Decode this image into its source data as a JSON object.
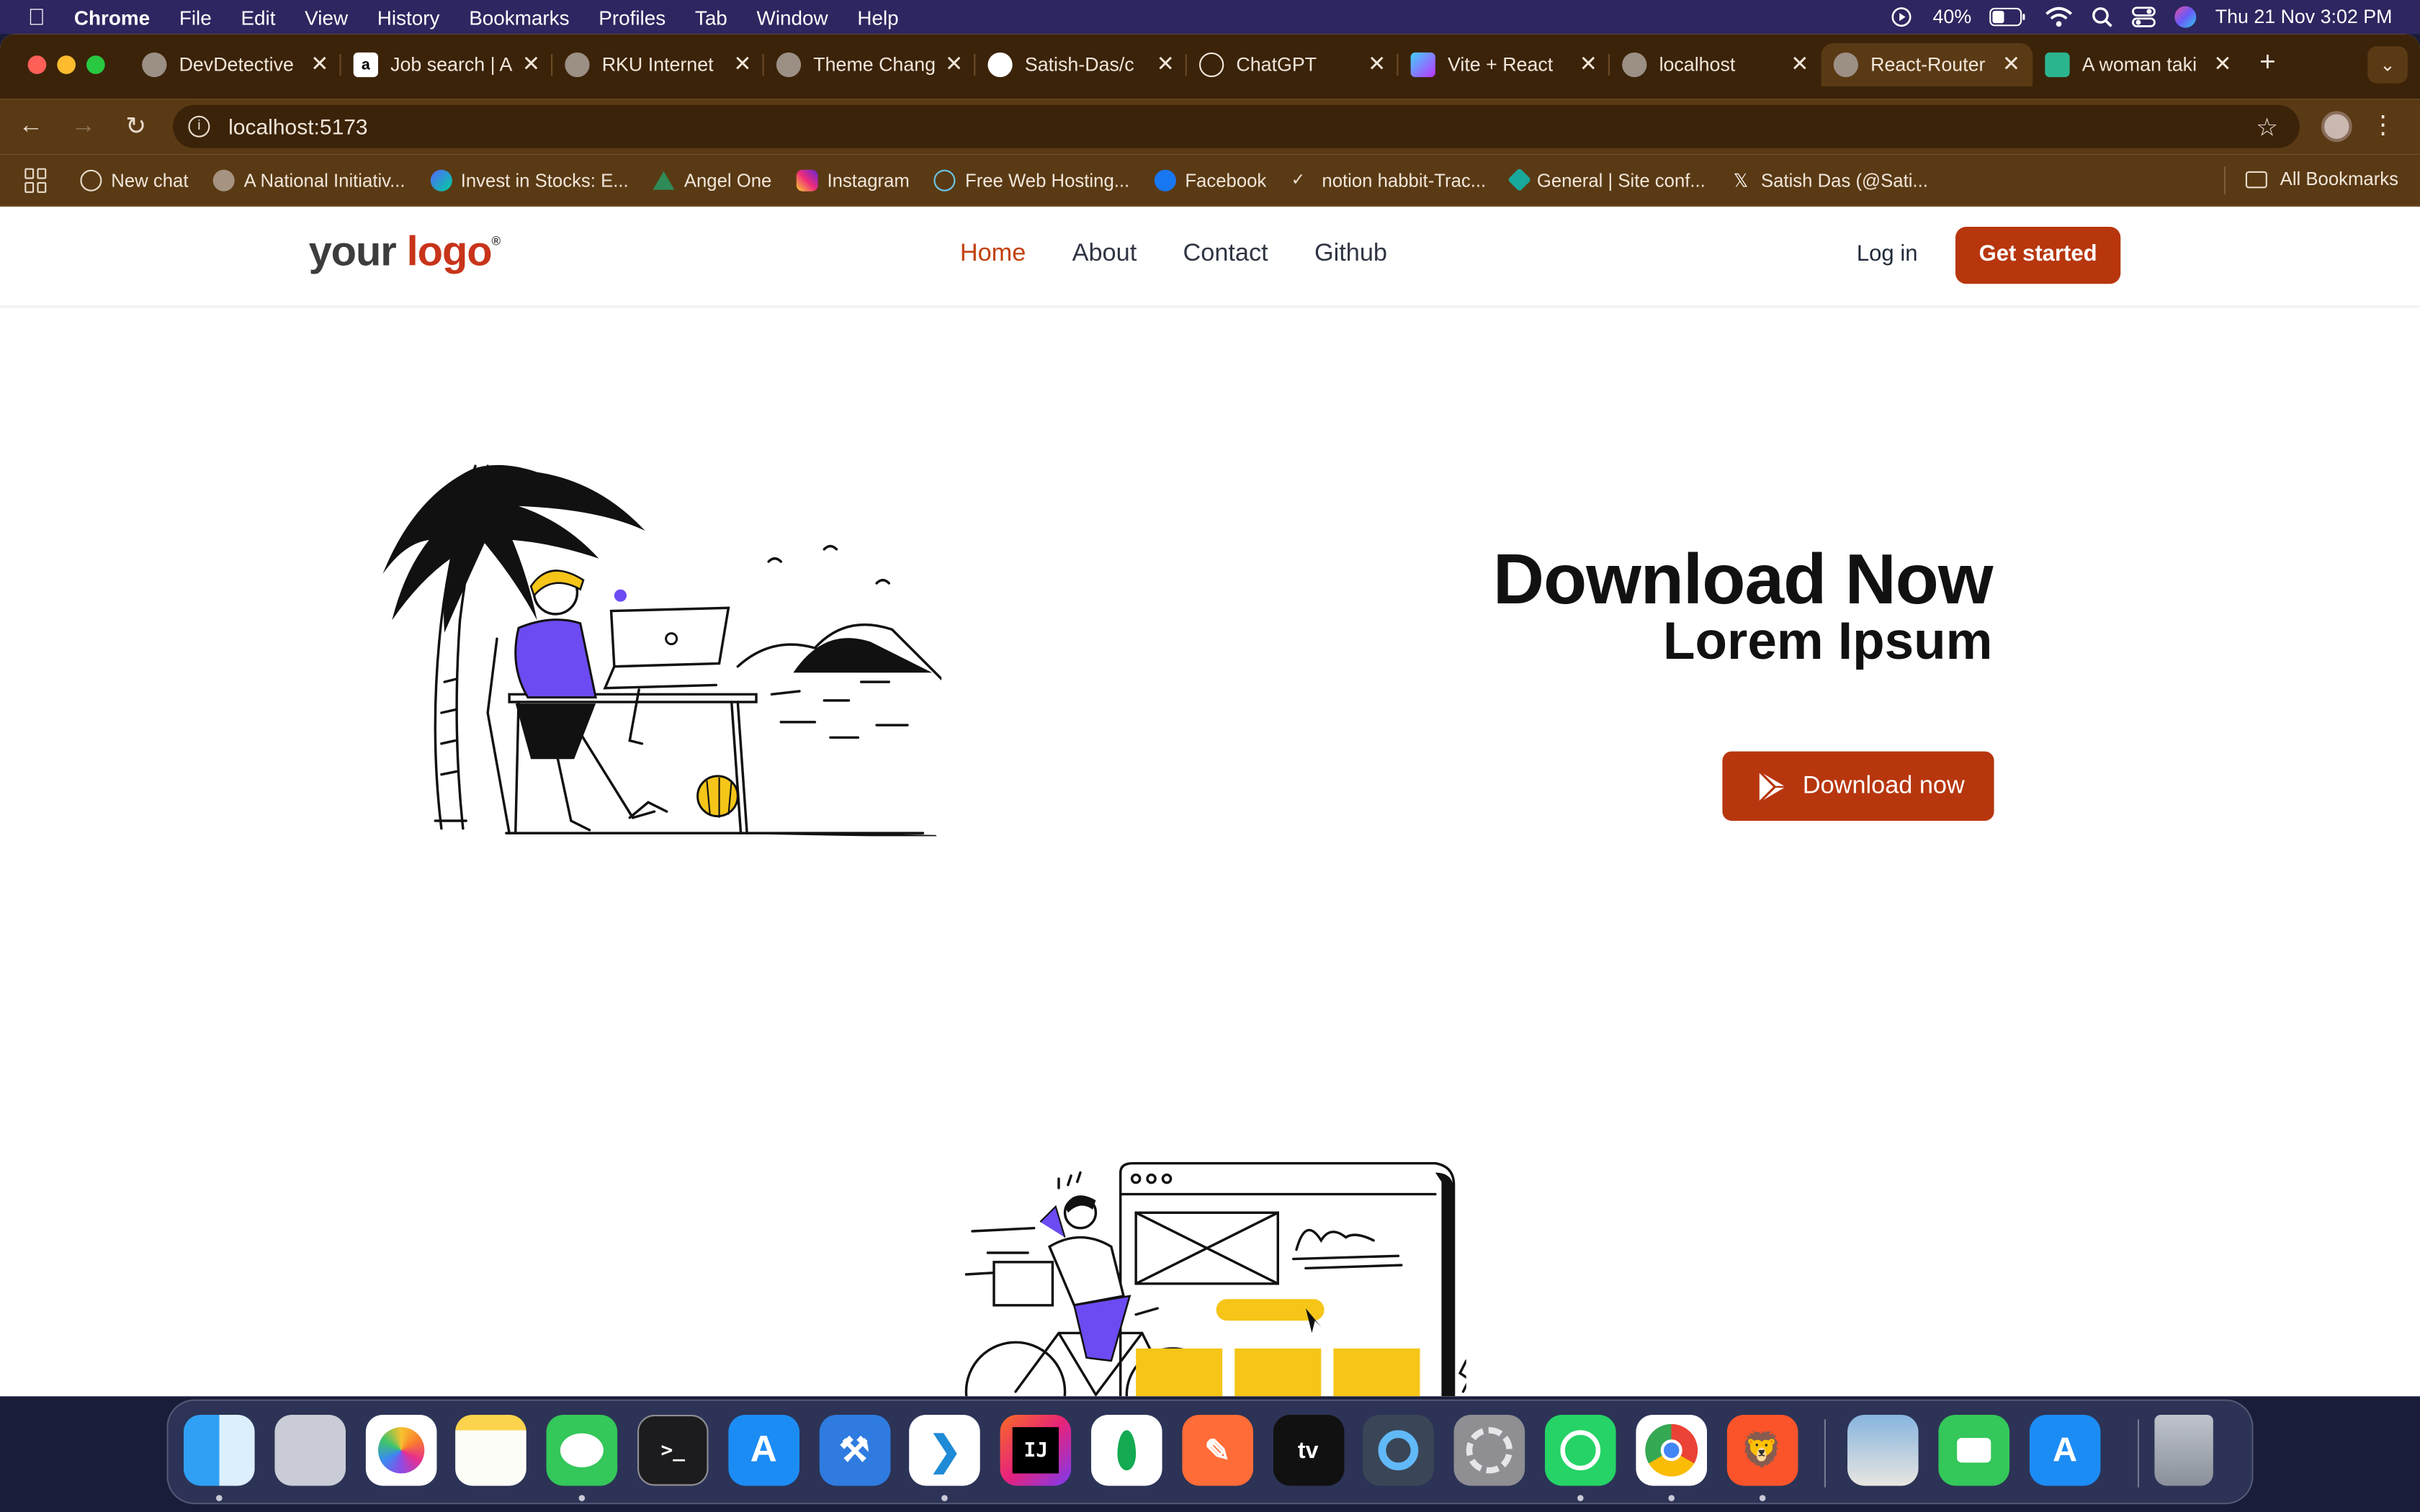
{
  "menubar": {
    "app": "Chrome",
    "items": [
      "File",
      "Edit",
      "View",
      "History",
      "Bookmarks",
      "Profiles",
      "Tab",
      "Window",
      "Help"
    ],
    "battery": "40%",
    "datetime": "Thu 21 Nov  3:02 PM"
  },
  "tabs": [
    {
      "label": "DevDetective",
      "icon": "globe-icon"
    },
    {
      "label": "Job search | A",
      "icon": "amazon-icon"
    },
    {
      "label": "RKU Internet",
      "icon": "globe-icon"
    },
    {
      "label": "Theme Chang",
      "icon": "globe-icon"
    },
    {
      "label": "Satish-Das/c",
      "icon": "github-icon"
    },
    {
      "label": "ChatGPT",
      "icon": "openai-icon"
    },
    {
      "label": "Vite + React",
      "icon": "vite-icon"
    },
    {
      "label": "localhost",
      "icon": "globe-icon"
    },
    {
      "label": "React-Router",
      "icon": "globe-icon",
      "active": true
    },
    {
      "label": "A woman taki",
      "icon": "generic-icon"
    }
  ],
  "address": {
    "url": "localhost:5173"
  },
  "bookmarks": [
    {
      "label": "New chat",
      "icon": "openai-icon"
    },
    {
      "label": "A National Initiativ...",
      "icon": "globe-icon"
    },
    {
      "label": "Invest in Stocks: E...",
      "icon": "groww-icon"
    },
    {
      "label": "Angel One",
      "icon": "angelone-icon"
    },
    {
      "label": "Instagram",
      "icon": "instagram-icon"
    },
    {
      "label": "Free Web Hosting...",
      "icon": "hosting-icon"
    },
    {
      "label": "Facebook",
      "icon": "facebook-icon"
    },
    {
      "label": "notion habbit-Trac...",
      "icon": "check-icon"
    },
    {
      "label": "General | Site conf...",
      "icon": "netlify-icon"
    },
    {
      "label": "Satish Das (@Sati...",
      "icon": "x-icon"
    }
  ],
  "all_bookmarks": "All Bookmarks",
  "site": {
    "logo_part1": "your ",
    "logo_part2": "logo",
    "logo_mark": "®",
    "nav": [
      "Home",
      "About",
      "Contact",
      "Github"
    ],
    "login": "Log in",
    "cta": "Get started",
    "hero_title": "Download Now",
    "hero_subtitle": "Lorem Ipsum",
    "download_button": "Download now"
  },
  "colors": {
    "brand": "#b7360e",
    "nav_active": "#c2410c",
    "illustration_accent": "#6c4bf2",
    "illustration_yellow": "#f5c518"
  },
  "dock": [
    "Finder",
    "Launchpad",
    "Photos",
    "Notes",
    "Messages",
    "Terminal",
    "App Store",
    "Xcode",
    "VS Code",
    "IntelliJ IDEA",
    "MongoDB Compass",
    "Postman",
    "Apple TV",
    "QuickTime",
    "System Settings",
    "WhatsApp",
    "Chrome",
    "Brave",
    "Preview",
    "FaceTime",
    "Simulator",
    "Trash"
  ]
}
